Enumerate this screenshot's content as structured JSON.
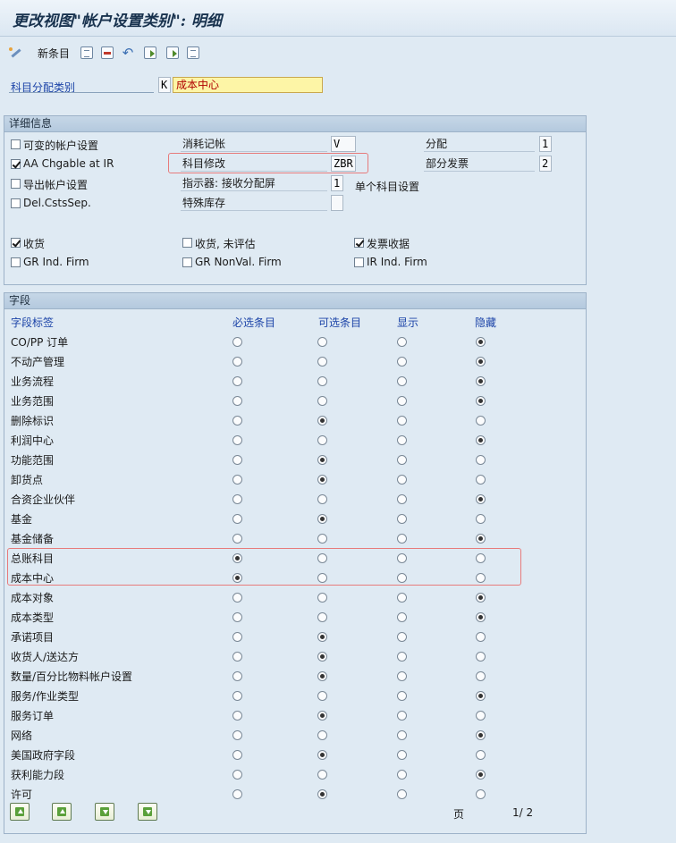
{
  "window": {
    "title": "更改视图\"帐户设置类别\": 明细"
  },
  "toolbar": {
    "new_entries": "新条目"
  },
  "header": {
    "acct_assign_label": "科目分配类别",
    "acct_assign_code": "K",
    "acct_assign_value": "成本中心"
  },
  "details": {
    "title": "详细信息",
    "left": [
      {
        "label": "可变的帐户设置",
        "checked": false
      },
      {
        "label": "AA Chgable at IR",
        "checked": true
      },
      {
        "label": "导出帐户设置",
        "checked": false
      },
      {
        "label": "Del.CstsSep.",
        "checked": false
      }
    ],
    "mid": [
      {
        "label": "消耗记帐",
        "value": "V"
      },
      {
        "label": "科目修改",
        "value": "ZBR"
      },
      {
        "label": "指示器: 接收分配屏",
        "value": "1"
      },
      {
        "label": "特殊库存",
        "value": ""
      }
    ],
    "single_account_text": "单个科目设置",
    "right": [
      {
        "label": "分配",
        "value": "1"
      },
      {
        "label": "部分发票",
        "value": "2"
      }
    ],
    "checks_row1": [
      {
        "label": "收货",
        "checked": true
      },
      {
        "label": "收货, 未评估",
        "checked": false
      },
      {
        "label": "发票收据",
        "checked": true
      }
    ],
    "checks_row2": [
      {
        "label": "GR Ind. Firm",
        "checked": false
      },
      {
        "label": "GR NonVal. Firm",
        "checked": false
      },
      {
        "label": "IR Ind. Firm",
        "checked": false
      }
    ]
  },
  "fields": {
    "title": "字段",
    "headers": [
      "字段标签",
      "必选条目",
      "可选条目",
      "显示",
      "隐藏"
    ],
    "rows": [
      {
        "label": "CO/PP 订单",
        "sel": 3
      },
      {
        "label": "不动产管理",
        "sel": 3
      },
      {
        "label": "业务流程",
        "sel": 3
      },
      {
        "label": "业务范围",
        "sel": 3
      },
      {
        "label": "删除标识",
        "sel": 1
      },
      {
        "label": "利润中心",
        "sel": 3
      },
      {
        "label": "功能范围",
        "sel": 1
      },
      {
        "label": "卸货点",
        "sel": 1
      },
      {
        "label": "合资企业伙伴",
        "sel": 3
      },
      {
        "label": "基金",
        "sel": 1
      },
      {
        "label": "基金储备",
        "sel": 3
      },
      {
        "label": "总账科目",
        "sel": 0
      },
      {
        "label": "成本中心",
        "sel": 0
      },
      {
        "label": "成本对象",
        "sel": 3
      },
      {
        "label": "成本类型",
        "sel": 3
      },
      {
        "label": "承诺项目",
        "sel": 1
      },
      {
        "label": "收货人/送达方",
        "sel": 1
      },
      {
        "label": "数量/百分比物料帐户设置",
        "sel": 1
      },
      {
        "label": "服务/作业类型",
        "sel": 3
      },
      {
        "label": "服务订单",
        "sel": 1
      },
      {
        "label": "网络",
        "sel": 3
      },
      {
        "label": "美国政府字段",
        "sel": 1
      },
      {
        "label": "获利能力段",
        "sel": 3
      },
      {
        "label": "许可",
        "sel": 1
      }
    ],
    "page_label": "页",
    "page_value": "1/ 2"
  }
}
